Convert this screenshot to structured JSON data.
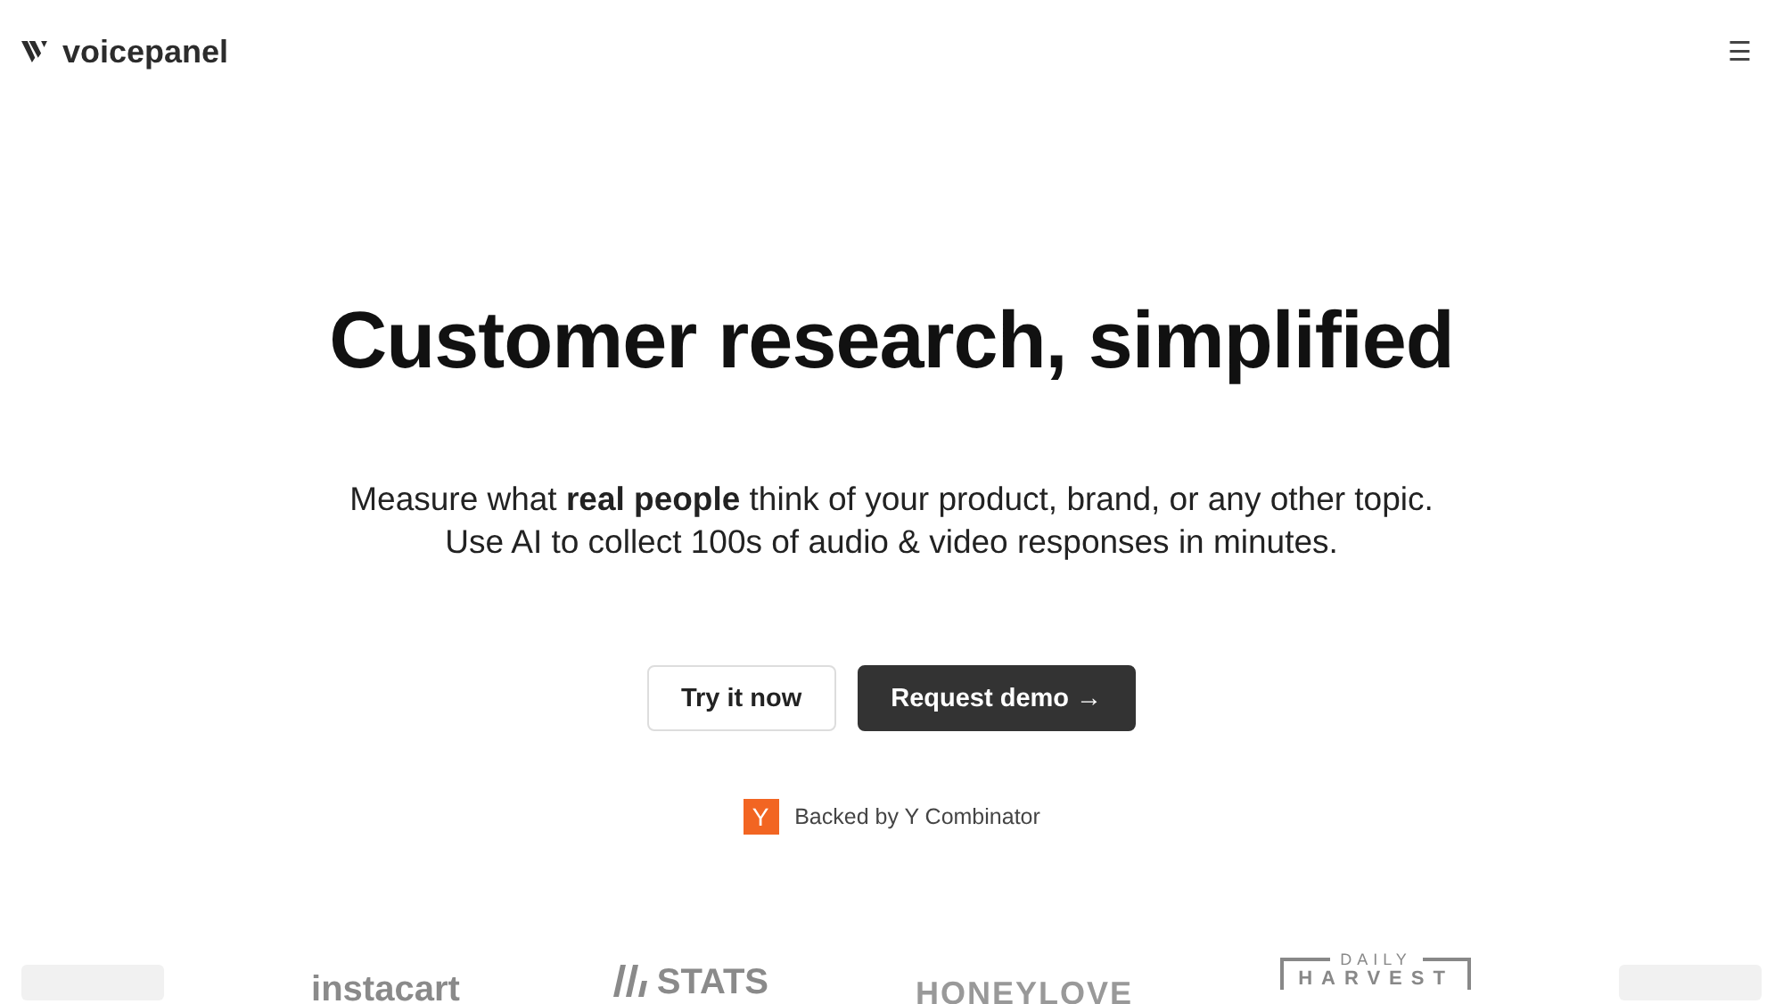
{
  "header": {
    "brand": "voicepanel",
    "menu_icon": "☰"
  },
  "hero": {
    "title": "Customer research, simplified",
    "subtitle": [
      "Measure what **real people** think of your product, brand, or any other topic.",
      "Use AI to collect 100s of audio & video responses in minutes."
    ],
    "buttons": [
      {
        "label": "Try it now",
        "kind": "secondary"
      },
      {
        "label": "Request demo →",
        "kind": "primary"
      }
    ],
    "backer": {
      "badge": "Y",
      "text": "Backed by Y Combinator"
    }
  },
  "logos": [
    {
      "kind": "faded"
    },
    {
      "kind": "instacart",
      "text": "instacart"
    },
    {
      "kind": "stats",
      "text": "STATS"
    },
    {
      "kind": "word",
      "text": "HONEYLOVE"
    },
    {
      "kind": "framed",
      "top": "DAILY",
      "text": "HARVEST"
    },
    {
      "kind": "faded"
    }
  ]
}
